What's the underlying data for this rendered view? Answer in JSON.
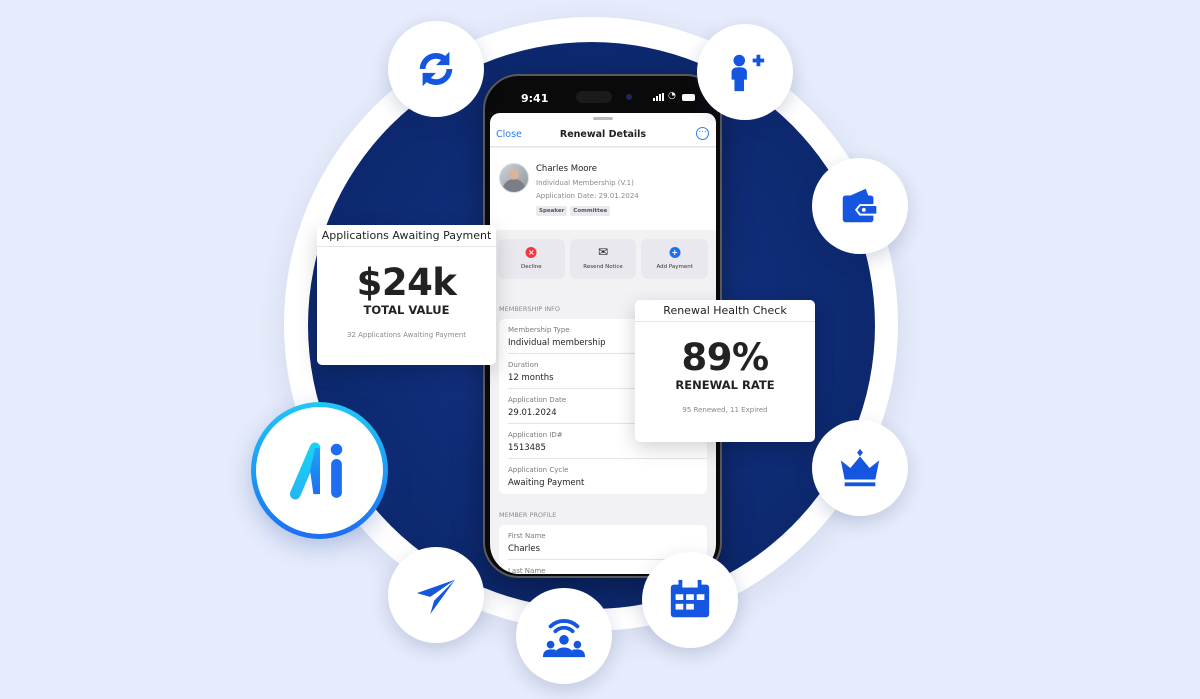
{
  "background_color": "#E6ECFB",
  "accent_color": "#1456E0",
  "phone": {
    "status_bar": {
      "time": "9:41"
    },
    "nav": {
      "close_label": "Close",
      "title": "Renewal Details",
      "more_icon": "ellipsis-circle-icon"
    },
    "profile": {
      "name": "Charles Moore",
      "membership": "Individual Membership (V.1)",
      "application_date": "Application Date: 29.01.2024",
      "tags": [
        "Speaker",
        "Committee"
      ]
    },
    "actions": [
      {
        "label": "Decline",
        "icon": "x-circle-icon",
        "color": "#F0393F"
      },
      {
        "label": "Resend Notice",
        "icon": "envelope-icon",
        "color": "#222222"
      },
      {
        "label": "Add Payment",
        "icon": "plus-circle-icon",
        "color": "#1E6EF2"
      }
    ],
    "membership_info": {
      "section_label": "MEMBERSHIP INFO",
      "rows": [
        {
          "key": "Membership Type",
          "value": "Individual membership"
        },
        {
          "key": "Duration",
          "value": "12 months"
        },
        {
          "key": "Application Date",
          "value": "29.01.2024"
        },
        {
          "key": "Application ID#",
          "value": "1513485"
        },
        {
          "key": "Application Cycle",
          "value": "Awaiting Payment"
        }
      ]
    },
    "member_profile": {
      "section_label": "MEMBER PROFILE",
      "rows": [
        {
          "key": "First Name",
          "value": "Charles"
        },
        {
          "key": "Last Name",
          "value": ""
        }
      ]
    }
  },
  "cards": {
    "payments": {
      "header": "Applications Awaiting Payment",
      "value": "$24k",
      "label": "TOTAL VALUE",
      "note": "32 Applications Awaiting Payment"
    },
    "health": {
      "header": "Renewal Health Check",
      "value": "89%",
      "label": "RENEWAL RATE",
      "note": "95 Renewed, 11 Expired"
    }
  },
  "feature_icons": [
    "sync-icon",
    "add-user-icon",
    "wallet-icon",
    "crown-icon",
    "calendar-icon",
    "community-broadcast-icon",
    "send-icon",
    "ai-logo-icon"
  ]
}
